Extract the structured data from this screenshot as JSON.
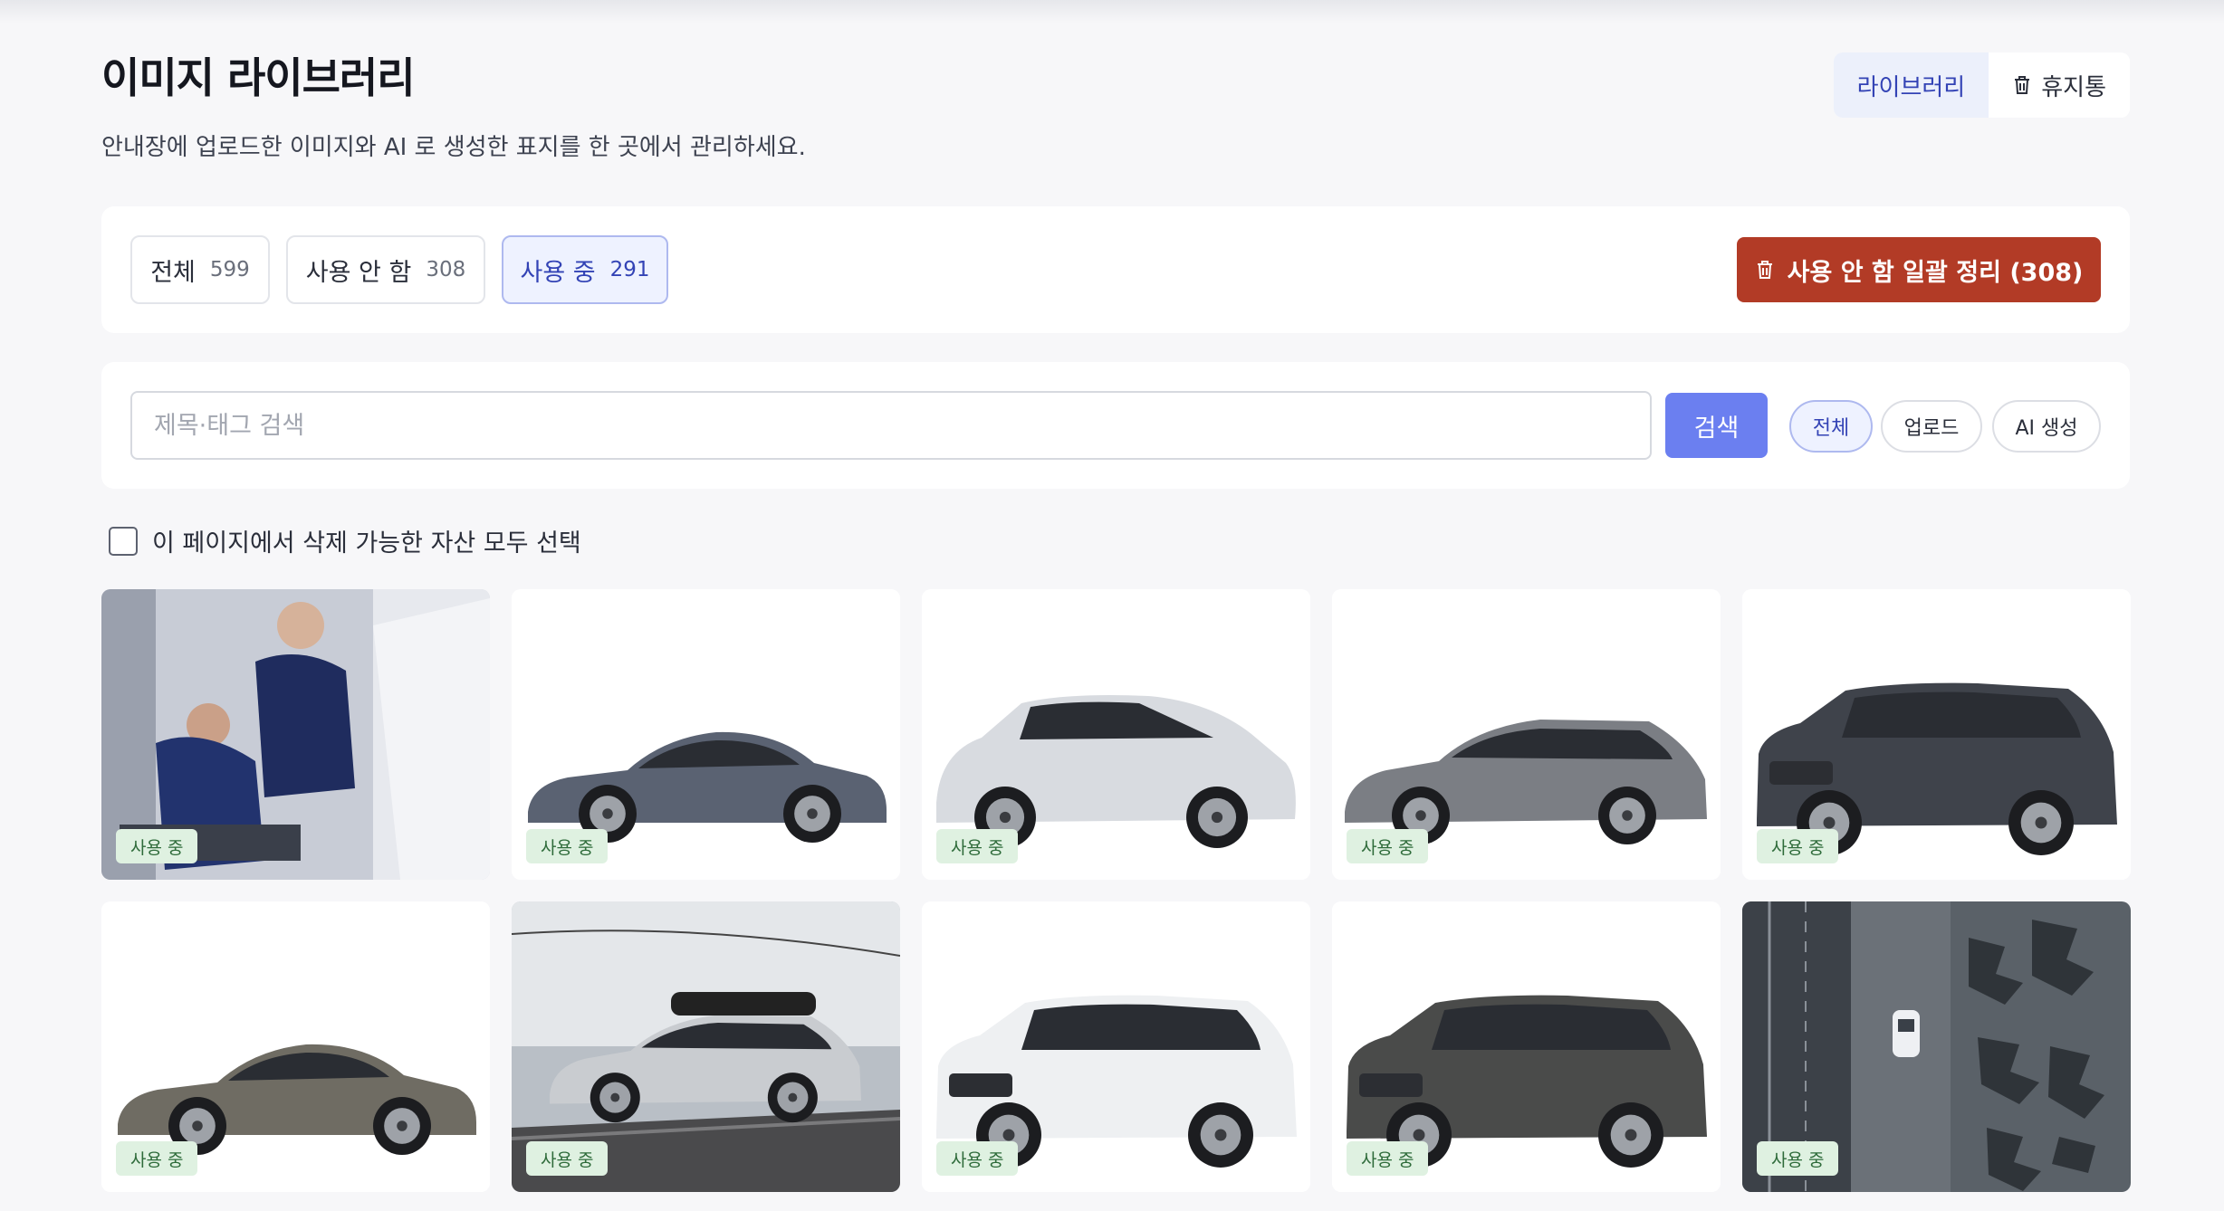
{
  "header": {
    "title": "이미지 라이브러리",
    "subtitle": "안내장에 업로드한 이미지와 AI 로 생성한 표지를 한 곳에서 관리하세요.",
    "view_toggle": [
      {
        "label": "라이브러리",
        "active": true
      },
      {
        "label": "휴지통",
        "icon": "trash-icon",
        "active": false
      }
    ]
  },
  "filters": {
    "tabs": [
      {
        "label": "전체",
        "count": "599",
        "active": false
      },
      {
        "label": "사용 안 함",
        "count": "308",
        "active": false
      },
      {
        "label": "사용 중",
        "count": "291",
        "active": true
      }
    ],
    "cleanup_label": "사용 안 함 일괄 정리 (308)",
    "cleanup_icon": "trash-icon"
  },
  "search": {
    "placeholder": "제목·태그 검색",
    "value": "",
    "button_label": "검색",
    "source_filters": [
      {
        "label": "전체",
        "active": true
      },
      {
        "label": "업로드",
        "active": false
      },
      {
        "label": "AI 생성",
        "active": false
      }
    ]
  },
  "select_all": {
    "label": "이 페이지에서 삭제 가능한 자산 모두 선택",
    "checked": false
  },
  "assets": [
    {
      "scene": "mechanics",
      "status": "사용 중"
    },
    {
      "scene": "sedan",
      "color": "#5a6272",
      "status": "사용 중"
    },
    {
      "scene": "hatch",
      "color": "#d8dbe0",
      "status": "사용 중"
    },
    {
      "scene": "wagon",
      "color": "#7b7e84",
      "status": "사용 중"
    },
    {
      "scene": "suv",
      "color": "#3f434b",
      "status": "사용 중"
    },
    {
      "scene": "sedan",
      "color": "#6f6c63",
      "status": "사용 중"
    },
    {
      "scene": "roadtrip",
      "color": "#c9ccd0",
      "status": "사용 중"
    },
    {
      "scene": "compactsuv",
      "color": "#eef0f2",
      "status": "사용 중"
    },
    {
      "scene": "suv",
      "color": "#4a4b4a",
      "status": "사용 중"
    },
    {
      "scene": "aerial",
      "status": "사용 중"
    }
  ],
  "colors": {
    "accent": "#3343b5",
    "search_button": "#6b7ff0",
    "danger_button": "#b23b26",
    "badge_bg": "#dff1e1",
    "badge_text": "#2e6b3a"
  }
}
